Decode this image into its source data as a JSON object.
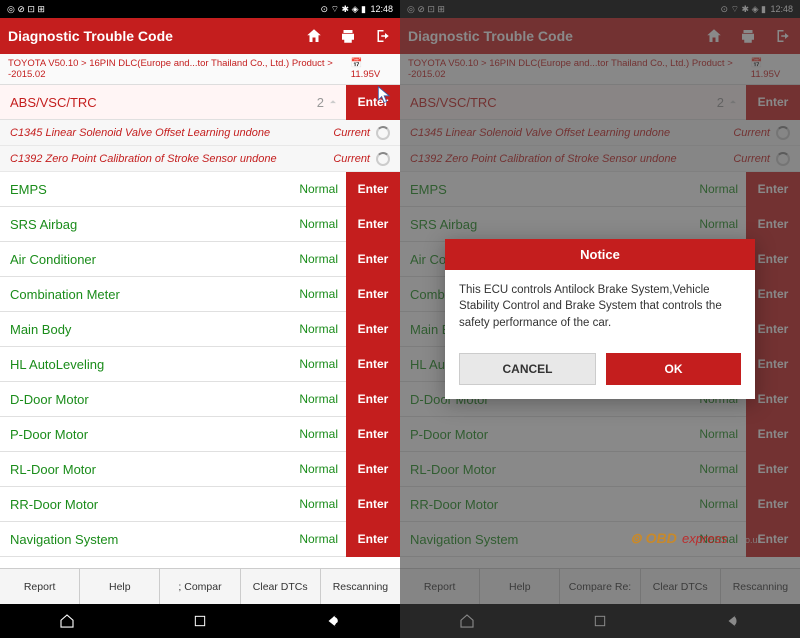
{
  "status": {
    "time": "12:48",
    "icons": "◎ ⊘ ⊡ ⊞",
    "right": "⊙ ⌔ ✱ ◈ ▮"
  },
  "header": {
    "title": "Diagnostic Trouble Code"
  },
  "breadcrumb": {
    "text": "TOYOTA V50.10 > 16PIN DLC(Europe and...tor Thailand Co., Ltd.) Product > -2015.02",
    "voltage": "11.95V"
  },
  "fault_row": {
    "label": "ABS/VSC/TRC",
    "count": "2",
    "enter": "Enter"
  },
  "dtcs": [
    {
      "label": "C1345 Linear Solenoid Valve Offset Learning undone",
      "status": "Current"
    },
    {
      "label": "C1392 Zero Point Calibration of Stroke Sensor undone",
      "status": "Current"
    }
  ],
  "rows": [
    {
      "label": "EMPS",
      "status": "Normal"
    },
    {
      "label": "SRS Airbag",
      "status": "Normal"
    },
    {
      "label": "Air Conditioner",
      "status": "Normal"
    },
    {
      "label": "Combination Meter",
      "status": "Normal"
    },
    {
      "label": "Main Body",
      "status": "Normal"
    },
    {
      "label": "HL AutoLeveling",
      "status": "Normal"
    },
    {
      "label": "D-Door Motor",
      "status": "Normal"
    },
    {
      "label": "P-Door Motor",
      "status": "Normal"
    },
    {
      "label": "RL-Door Motor",
      "status": "Normal"
    },
    {
      "label": "RR-Door Motor",
      "status": "Normal"
    },
    {
      "label": "Navigation System",
      "status": "Normal"
    }
  ],
  "enter": "Enter",
  "bottom_left": [
    "Report",
    "Help",
    ";   Compar",
    "Clear DTCs",
    "Rescanning"
  ],
  "bottom_right": [
    "Report",
    "Help",
    "Compare Re:",
    "Clear DTCs",
    "Rescanning"
  ],
  "dialog": {
    "title": "Notice",
    "body": "This ECU controls Antilock Brake System,Vehicle Stability Control and Brake System that controls the safety performance of the car.",
    "cancel": "CANCEL",
    "ok": "OK"
  },
  "right_rows": {
    "combina": "Combina",
    "mainbod": "Main Bod",
    "hlauto": "HL AutoL"
  },
  "watermark": "OBDexpress.co.uk"
}
